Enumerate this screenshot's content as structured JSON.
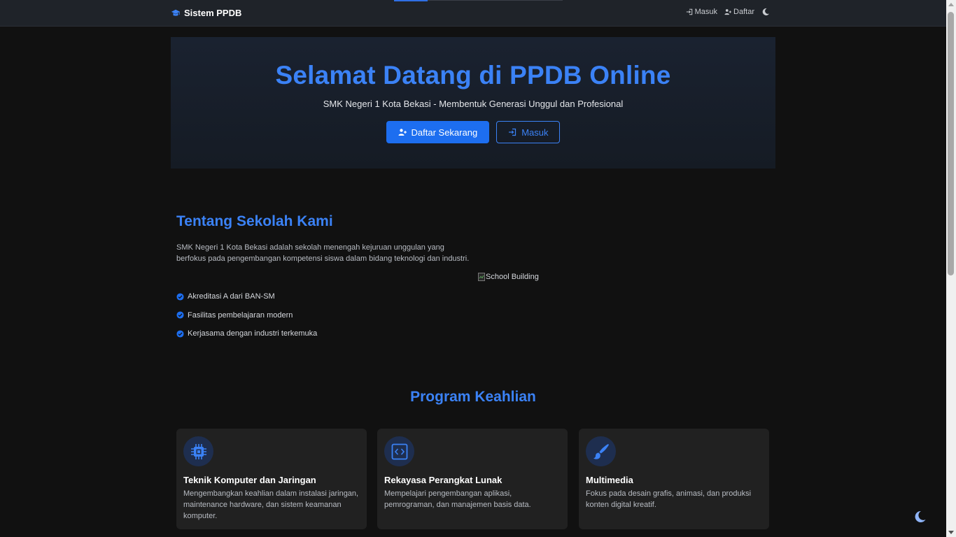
{
  "nav": {
    "brand": "Sistem PPDB",
    "brand_icon": "graduation-cap-icon",
    "login_label": "Masuk",
    "register_label": "Daftar",
    "theme_icon": "moon-icon"
  },
  "hero": {
    "title": "Selamat Datang di PPDB Online",
    "subtitle": "SMK Negeri 1 Kota Bekasi - Membentuk Generasi Unggul dan Profesional",
    "register_button": "Daftar Sekarang",
    "login_button": "Masuk"
  },
  "about": {
    "title": "Tentang Sekolah Kami",
    "description": "SMK Negeri 1 Kota Bekasi adalah sekolah menengah kejuruan unggulan yang berfokus pada pengembangan kompetensi siswa dalam bidang teknologi dan industri.",
    "features": [
      "Akreditasi A dari BAN-SM",
      "Fasilitas pembelajaran modern",
      "Kerjasama dengan industri terkemuka"
    ],
    "image_alt": "School Building"
  },
  "programs": {
    "title": "Program Keahlian",
    "items": [
      {
        "icon": "cpu-icon",
        "title": "Teknik Komputer dan Jaringan",
        "description": "Mengembangkan keahlian dalam instalasi jaringan, maintenance hardware, dan sistem keamanan komputer."
      },
      {
        "icon": "code-icon",
        "title": "Rekayasa Perangkat Lunak",
        "description": "Mempelajari pengembangan aplikasi, pemrograman, dan manajemen basis data."
      },
      {
        "icon": "brush-icon",
        "title": "Multimedia",
        "description": "Fokus pada desain grafis, animasi, dan produksi konten digital kreatif."
      }
    ]
  },
  "colors": {
    "accent": "#3b82f6",
    "primary_button": "#1d6ef0",
    "background": "#111111",
    "navbar": "#1f2329",
    "card": "#212121"
  }
}
